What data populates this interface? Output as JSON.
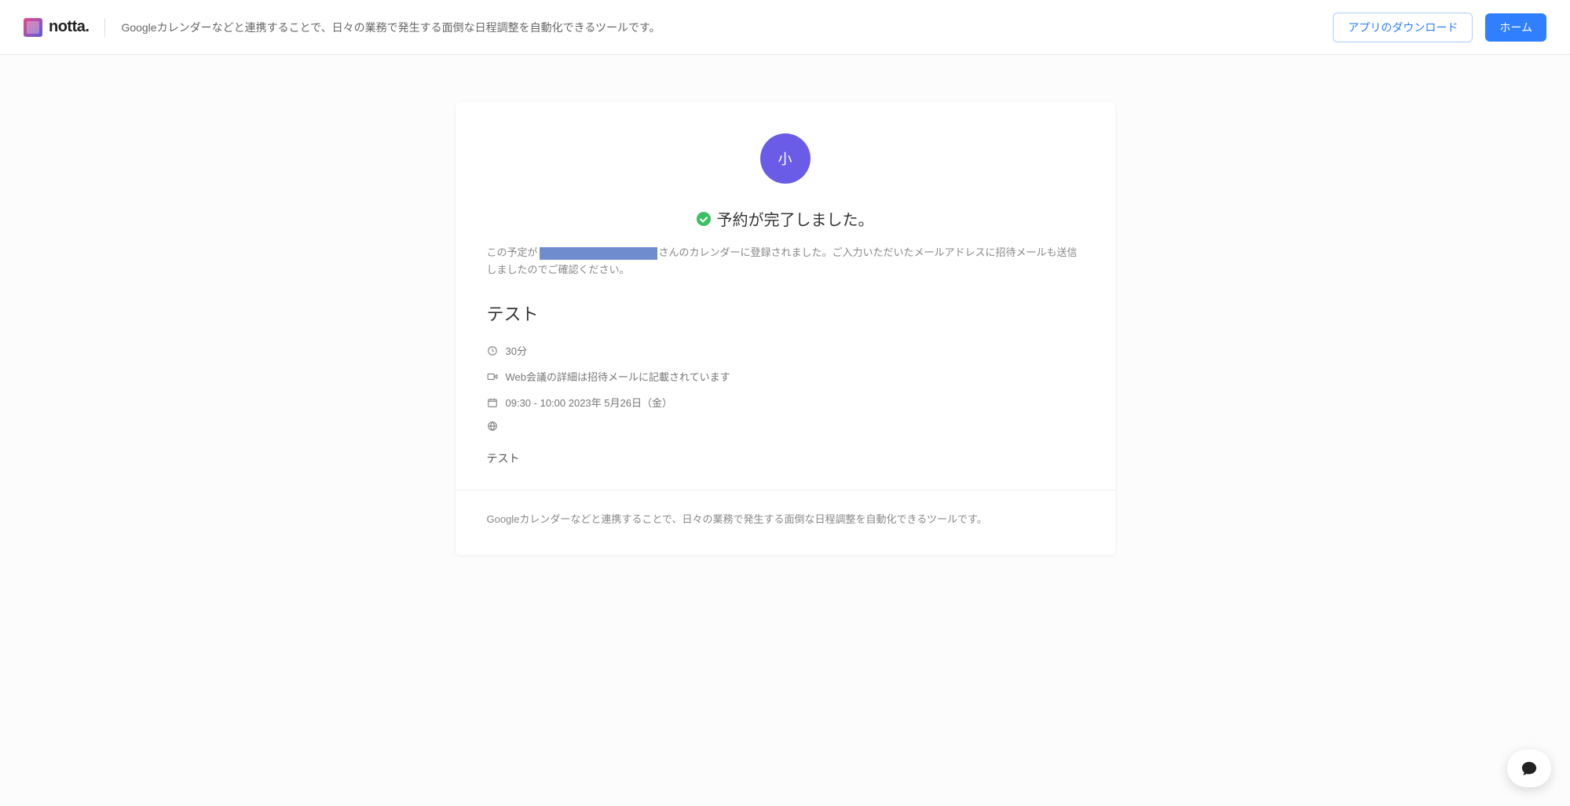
{
  "header": {
    "logo_text": "notta.",
    "tagline": "Googleカレンダーなどと連携することで、日々の業務で発生する面倒な日程調整を自動化できるツールです。",
    "download_button": "アプリのダウンロード",
    "home_button": "ホーム"
  },
  "card": {
    "avatar_initial": "小",
    "success_title": "予約が完了しました。",
    "subtitle_prefix": "この予定が",
    "subtitle_suffix": "さんのカレンダーに登録されました。ご入力いただいたメールアドレスに招待メールも送信しましたのでご確認ください。",
    "event_title": "テスト",
    "duration": "30分",
    "meeting_info": "Web会議の詳細は招待メールに記載されています",
    "datetime": "09:30 - 10:00 2023年 5月26日（金）",
    "note": "テスト",
    "footer_text": "Googleカレンダーなどと連携することで、日々の業務で発生する面倒な日程調整を自動化できるツールです。"
  }
}
